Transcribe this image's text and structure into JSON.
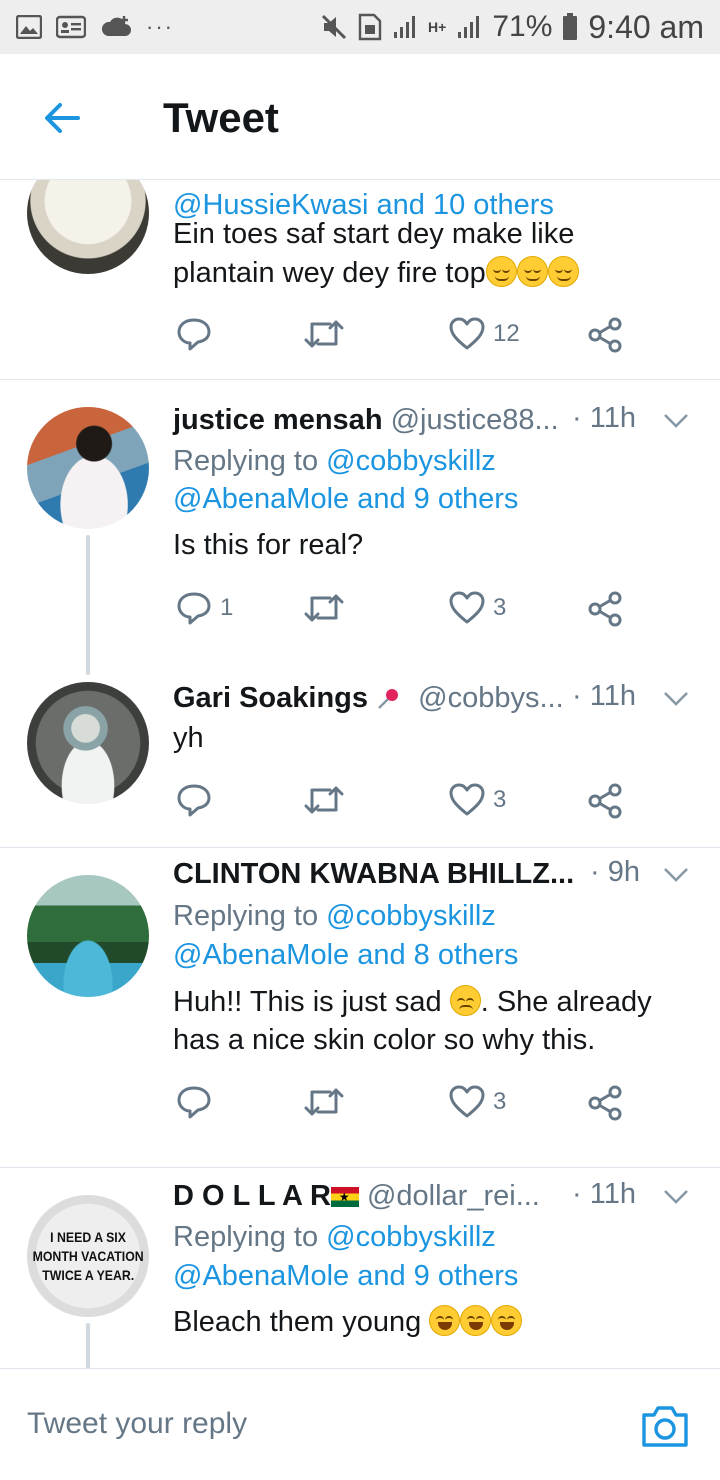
{
  "status_bar": {
    "network_label": "H+",
    "battery_percent": "71%",
    "time": "9:40 am"
  },
  "header": {
    "title": "Tweet"
  },
  "tweets": [
    {
      "mention_line": "@HussieKwasi and 10 others",
      "text_line1": "Ein toes saf start dey make like",
      "text_line2": "plantain wey dey fire top",
      "emoji": [
        "relieved-face",
        "relieved-face",
        "relieved-face"
      ],
      "reply_count": "",
      "like_count": "12"
    },
    {
      "name": "justice mensah",
      "handle": "@justice88...",
      "time": "· 11h",
      "replying_label": "Replying to",
      "replying_to": "@cobbyskillz",
      "others_line": "@AbenaMole and 9 others",
      "text_line1": "Is this for real?",
      "reply_count": "1",
      "like_count": "3"
    },
    {
      "name": "Gari Soakings",
      "name_emoji": "pushpin",
      "handle": "@cobbys...",
      "time": "· 11h",
      "text_line1": "yh",
      "reply_count": "",
      "like_count": "3"
    },
    {
      "name": "CLINTON KWABNA BHILLZ...",
      "time": "· 9h",
      "replying_label": "Replying to",
      "replying_to": "@cobbyskillz",
      "others_line": "@AbenaMole and 8 others",
      "text_line1a": "Huh!! This is just sad",
      "text_line1b": ". She already",
      "emoji": [
        "disappointed-face"
      ],
      "text_line2": "has a nice skin color so why this.",
      "reply_count": "",
      "like_count": "3"
    },
    {
      "name": "D O L L A R",
      "name_emoji": "ghana-flag",
      "handle": "@dollar_rei...",
      "time": "· 11h",
      "replying_label": "Replying to",
      "replying_to": "@cobbyskillz",
      "others_line": "@AbenaMole and 9 others",
      "text_line1": "Bleach them young",
      "emoji": [
        "rolling-laughing-face",
        "rolling-laughing-face",
        "rolling-laughing-face"
      ],
      "avatar_text_1": "I NEED A SIX",
      "avatar_text_2": "MONTH VACATION",
      "avatar_text_3": "TWICE A YEAR."
    }
  ],
  "reply_bar": {
    "placeholder": "Tweet your reply"
  },
  "colors": {
    "link": "#1b95e0",
    "muted": "#657786",
    "text": "#14171a"
  }
}
